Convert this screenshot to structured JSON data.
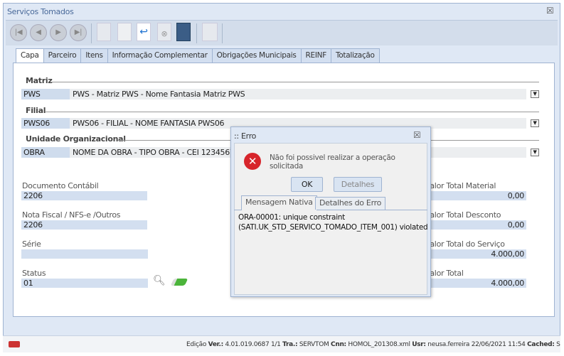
{
  "window": {
    "title": "Serviços Tomados",
    "close_icon": "close-icon"
  },
  "toolbar": {
    "buttons": [
      "first",
      "previous",
      "next",
      "last",
      "new",
      "edit",
      "confirm",
      "cancel",
      "save",
      "lock"
    ]
  },
  "tabs": [
    "Capa",
    "Parceiro",
    "Itens",
    "Informação Complementar",
    "Obrigações Municipais",
    "REINF",
    "Totalização"
  ],
  "form": {
    "matriz": {
      "label": "Matriz",
      "code": "PWS",
      "value": "PWS - Matriz PWS - Nome Fantasia Matriz PWS"
    },
    "filial": {
      "label": "Filial",
      "code": "PWS06",
      "value": "PWS06 - FILIAL - NOME FANTASIA PWS06"
    },
    "unidade": {
      "label": "Unidade Organizacional",
      "code": "OBRA",
      "value": "NOME DA OBRA - TIPO OBRA - CEI 123456789"
    },
    "documento_contabil": {
      "label": "Documento Contábil",
      "value": "2206"
    },
    "nota_fiscal": {
      "label": "Nota Fiscal / NFS-e /Outros",
      "value": "2206"
    },
    "serie": {
      "label": "Série",
      "value": ""
    },
    "status": {
      "label": "Status",
      "value": "01"
    },
    "valor_total_material": {
      "label": "Valor Total Material",
      "value": "0,00"
    },
    "valor_total_desconto": {
      "label": "Valor Total Desconto",
      "value": "0,00"
    },
    "valor_total_servico": {
      "label": "Valor Total do Serviço",
      "value": "4.000,00"
    },
    "valor_total": {
      "label": "Valor Total",
      "value": "4.000,00"
    }
  },
  "statusbar": {
    "mode": "Edição",
    "ver_label": "Ver.:",
    "ver": "4.01.019.0687",
    "page": "1/1",
    "tra_label": "Tra.:",
    "tra": "SERVTOM",
    "cnn_label": "Cnn:",
    "cnn": "HOMOL_201308.xml",
    "usr_label": "Usr:",
    "usr": "neusa.ferreira",
    "datetime": "22/06/2021 11:54",
    "cached_label": "Cached:",
    "cached": "S"
  },
  "dialog": {
    "title": ":: Erro",
    "message": "Não foi possivel realizar a operação solicitada",
    "ok": "OK",
    "details": "Detalhes",
    "tabs": [
      "Mensagem Nativa",
      "Detalhes do Erro"
    ],
    "native_line1": "ORA-00001: unique constraint",
    "native_line2": "(SATI.UK_STD_SERVICO_TOMADO_ITEM_001) violated"
  }
}
